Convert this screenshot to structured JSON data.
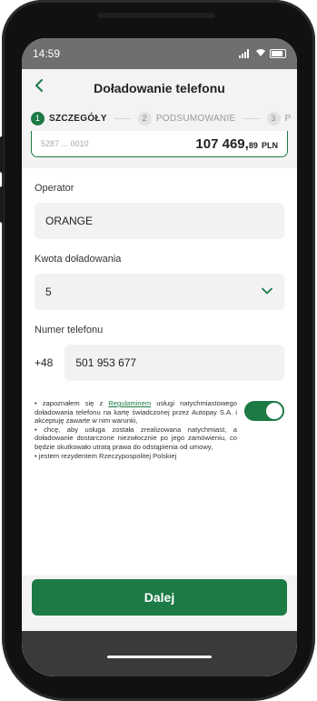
{
  "status_bar": {
    "time": "14:59"
  },
  "header": {
    "title": "Doładowanie telefonu",
    "back_icon": "chevron-left-icon"
  },
  "stepper": {
    "steps": [
      {
        "number": "1",
        "label": "SZCZEGÓŁY"
      },
      {
        "number": "2",
        "label": "PODSUMOWANIE"
      },
      {
        "number": "3",
        "label": "P"
      }
    ]
  },
  "account": {
    "number": "5287 ... 0010",
    "balance_main": "107 469,",
    "balance_decimal": "89",
    "currency": "PLN"
  },
  "form": {
    "operator_label": "Operator",
    "operator_value": "ORANGE",
    "amount_label": "Kwota doładowania",
    "amount_value": "5",
    "phone_label": "Numer telefonu",
    "phone_prefix": "+48",
    "phone_value": "501 953 677"
  },
  "consent": {
    "text_before_link": "• zapoznałem się z ",
    "link_text": "Regulaminem",
    "text_after_link": " usługi natychmiastowego doładowania telefonu na kartę świadczonej przez Autopay S.A. i akceptuję zawarte w nim warunki,",
    "line2": "• chcę, aby usługa została zrealizowana natychmiast, a doładowanie dostarczone niezwłocznie po jego zamówieniu, co będzie skutkowało utratą prawa do odstąpienia od umowy,",
    "line3": "• jestem rezydentem Rzeczypospolitej Polskiej",
    "toggle_state": "on"
  },
  "cta": {
    "label": "Dalej"
  },
  "colors": {
    "accent": "#1c7a45"
  }
}
